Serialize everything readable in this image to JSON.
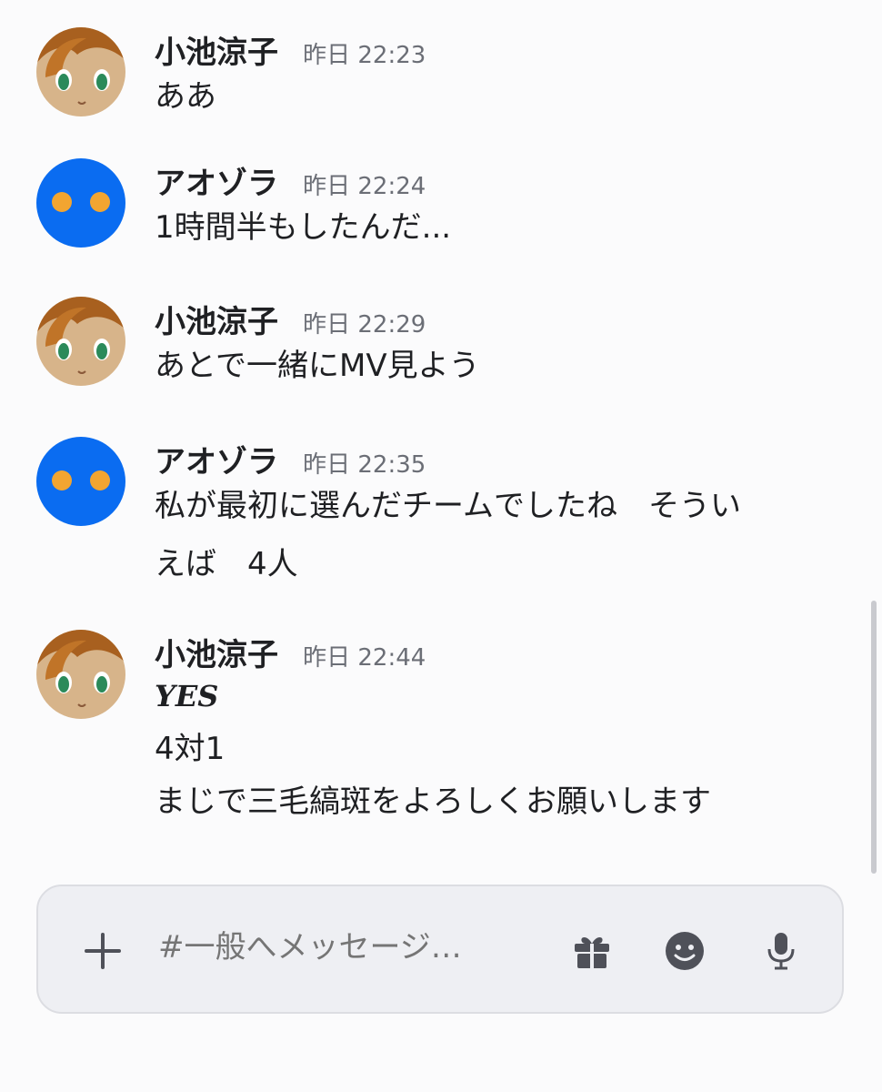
{
  "messages": [
    {
      "author": "小池涼子",
      "time": "昨日 22:23",
      "avatar": "ryoko-avatar-icon",
      "lines": [
        "ああ"
      ]
    },
    {
      "author": "アオゾラ",
      "time": "昨日 22:24",
      "avatar": "aozora-avatar-icon",
      "lines": [
        "1時間半もしたんだ..."
      ]
    },
    {
      "author": "小池涼子",
      "time": "昨日 22:29",
      "avatar": "ryoko-avatar-icon",
      "lines": [
        "あとで一緒にMV見よう"
      ]
    },
    {
      "author": "アオゾラ",
      "time": "昨日 22:35",
      "avatar": "aozora-avatar-icon",
      "lines": [
        "私が最初に選んだチームでしたね　そうい",
        "えば　4人"
      ]
    },
    {
      "author": "小池涼子",
      "time": "昨日 22:44",
      "avatar": "ryoko-avatar-icon",
      "emphasis": "YES",
      "lines": [
        "4対1",
        "まじで三毛縞斑をよろしくお願いします"
      ]
    }
  ],
  "composer": {
    "placeholder": "#一般へメッセージ…",
    "icons": [
      "plus-icon",
      "gift-icon",
      "emoji-icon",
      "microphone-icon"
    ]
  },
  "colors": {
    "aozora_avatar_bg": "#0a6cf1",
    "aozora_dots": "#f2a531",
    "icon_gray": "#4f5159"
  }
}
